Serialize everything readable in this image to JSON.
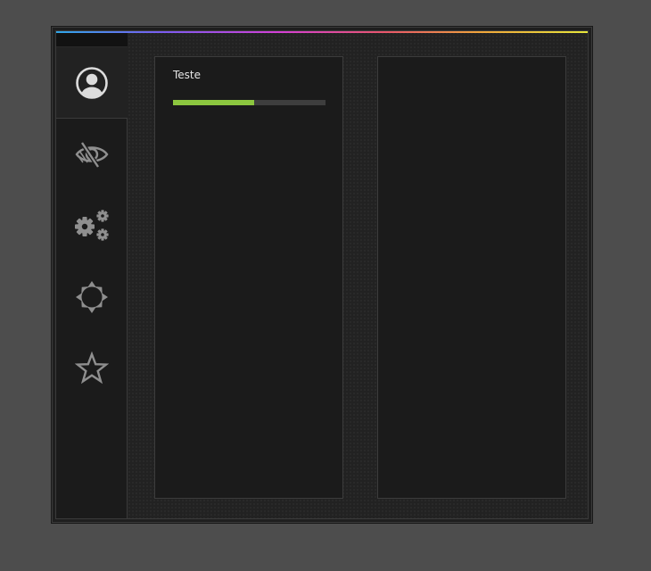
{
  "sidebar": {
    "items": [
      {
        "icon": "user-circle-icon",
        "active": true
      },
      {
        "icon": "eye-slash-icon",
        "active": false
      },
      {
        "icon": "gears-icon",
        "active": false
      },
      {
        "icon": "sun-icon",
        "active": false
      },
      {
        "icon": "star-icon",
        "active": false
      }
    ]
  },
  "main": {
    "panel_left": {
      "title": "Teste",
      "progress": 0.53
    }
  },
  "colors": {
    "background": "#4d4d4d",
    "window": "#222222",
    "panel": "#1b1b1b",
    "accent_progress": "#8cc63f",
    "icon": "#8f8f8f",
    "icon_active": "#dcdcdc"
  }
}
